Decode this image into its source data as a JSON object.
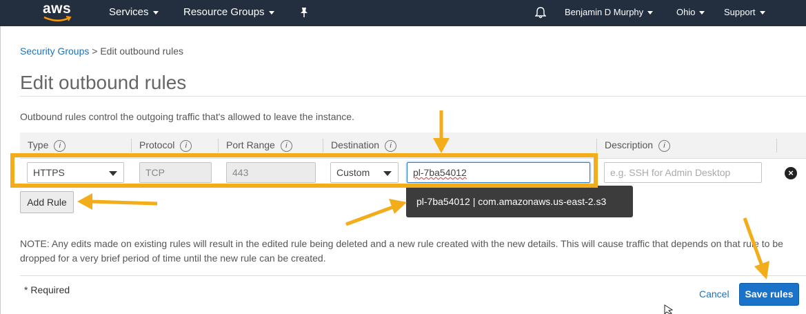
{
  "header": {
    "logo": "aws",
    "services": "Services",
    "resource_groups": "Resource Groups",
    "pin_icon": "pin-icon",
    "bell_icon": "bell-icon",
    "user": "Benjamin D Murphy",
    "region": "Ohio",
    "support": "Support"
  },
  "breadcrumb": {
    "link": "Security Groups",
    "separator": ">",
    "current": "Edit outbound rules"
  },
  "page": {
    "title": "Edit outbound rules",
    "description": "Outbound rules control the outgoing traffic that's allowed to leave the instance."
  },
  "table": {
    "columns": {
      "type": "Type",
      "protocol": "Protocol",
      "port_range": "Port Range",
      "destination": "Destination",
      "description": "Description"
    },
    "info_glyph": "i",
    "row": {
      "type": "HTTPS",
      "protocol": "TCP",
      "port_range": "443",
      "destination_mode": "Custom",
      "destination_value": "pl-7ba54012",
      "description_placeholder": "e.g. SSH for Admin Desktop",
      "remove_icon": "×"
    }
  },
  "tooltip": "pl-7ba54012 | com.amazonaws.us-east-2.s3",
  "add_rule": "Add Rule",
  "note": "NOTE: Any edits made on existing rules will result in the edited rule being deleted and a new rule created with the new details. This will cause traffic that depends on that rule to be dropped for a very brief period of time until the new rule can be created.",
  "footer": {
    "required": "* Required",
    "cancel": "Cancel",
    "save": "Save rules"
  },
  "colors": {
    "topbar": "#232f3e",
    "link": "#1f72b8",
    "primary": "#1a73c9",
    "annotation": "#f3ac1a"
  }
}
